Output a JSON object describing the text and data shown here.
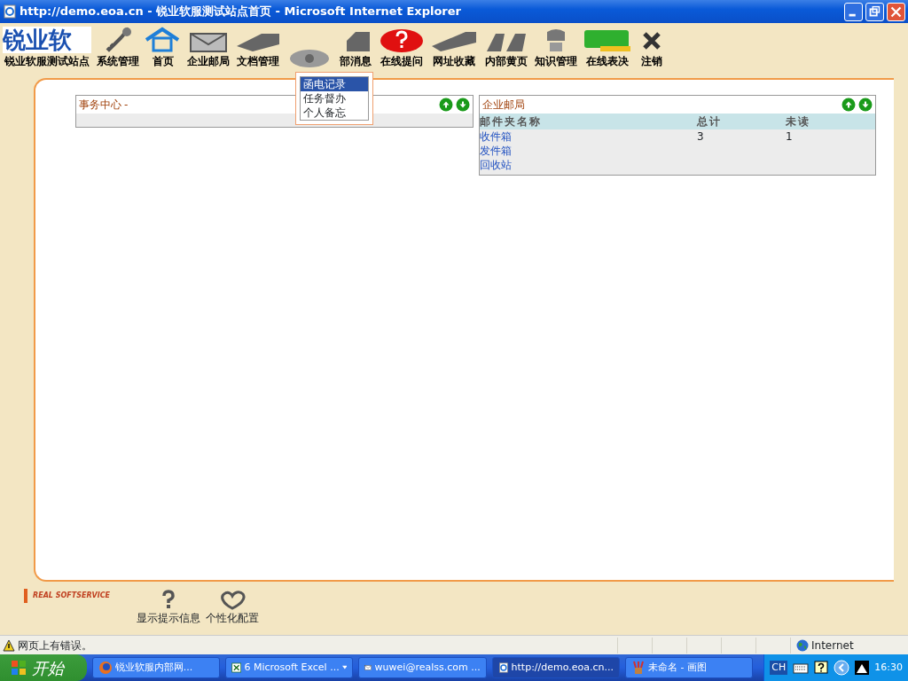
{
  "window": {
    "title": "http://demo.eoa.cn - 锐业软服测试站点首页 - Microsoft Internet Explorer"
  },
  "toolbar": {
    "logo_text": "锐业软",
    "items": [
      {
        "label": "锐业软服测试站点",
        "kind": "logo"
      },
      {
        "label": "系统管理",
        "kind": "tool"
      },
      {
        "label": "首页",
        "kind": "tool"
      },
      {
        "label": "企业邮局",
        "kind": "tool"
      },
      {
        "label": "文档管理",
        "kind": "tool"
      },
      {
        "kind": "tool"
      },
      {
        "label": "部消息",
        "kind": "tool"
      },
      {
        "label": "在线提问",
        "kind": "tool"
      },
      {
        "label": "网址收藏",
        "kind": "tool"
      },
      {
        "label": "内部黄页",
        "kind": "tool"
      },
      {
        "label": "知识管理",
        "kind": "tool"
      },
      {
        "label": "在线表决",
        "kind": "tool"
      },
      {
        "label": "注销",
        "kind": "tool"
      }
    ]
  },
  "dropdown_menu": [
    {
      "label": "函电记录",
      "selected": true
    },
    {
      "label": "任务督办",
      "selected": false
    },
    {
      "label": "个人备忘",
      "selected": false
    }
  ],
  "affairs_panel": {
    "title": "事务中心",
    "suffix": "-"
  },
  "mail_panel": {
    "title": "企业邮局",
    "columns": [
      "邮件夹名称",
      "总计",
      "未读"
    ],
    "rows": [
      {
        "name": "收件箱",
        "total": "3",
        "unread": "1"
      },
      {
        "name": "发件箱"
      },
      {
        "name": "回收站"
      }
    ]
  },
  "footer": {
    "logo_text": "REAL SOFTSERVICE",
    "items": [
      {
        "label": "显示提示信息"
      },
      {
        "label": "个性化配置"
      }
    ]
  },
  "status_bar": {
    "message": "网页上有错误。",
    "zone": "Internet"
  },
  "taskbar": {
    "start": "开始",
    "tasks": [
      {
        "label": "锐业软服内部网...",
        "selected": false
      },
      {
        "label": "6 Microsoft Excel ...",
        "selected": false,
        "group": true
      },
      {
        "label": "wuwei@realss.com ...",
        "selected": false
      },
      {
        "label": "http://demo.eoa.cn...",
        "selected": true
      },
      {
        "label": "未命名 - 画图",
        "selected": false
      }
    ],
    "language": "CH",
    "clock": "16:30"
  }
}
